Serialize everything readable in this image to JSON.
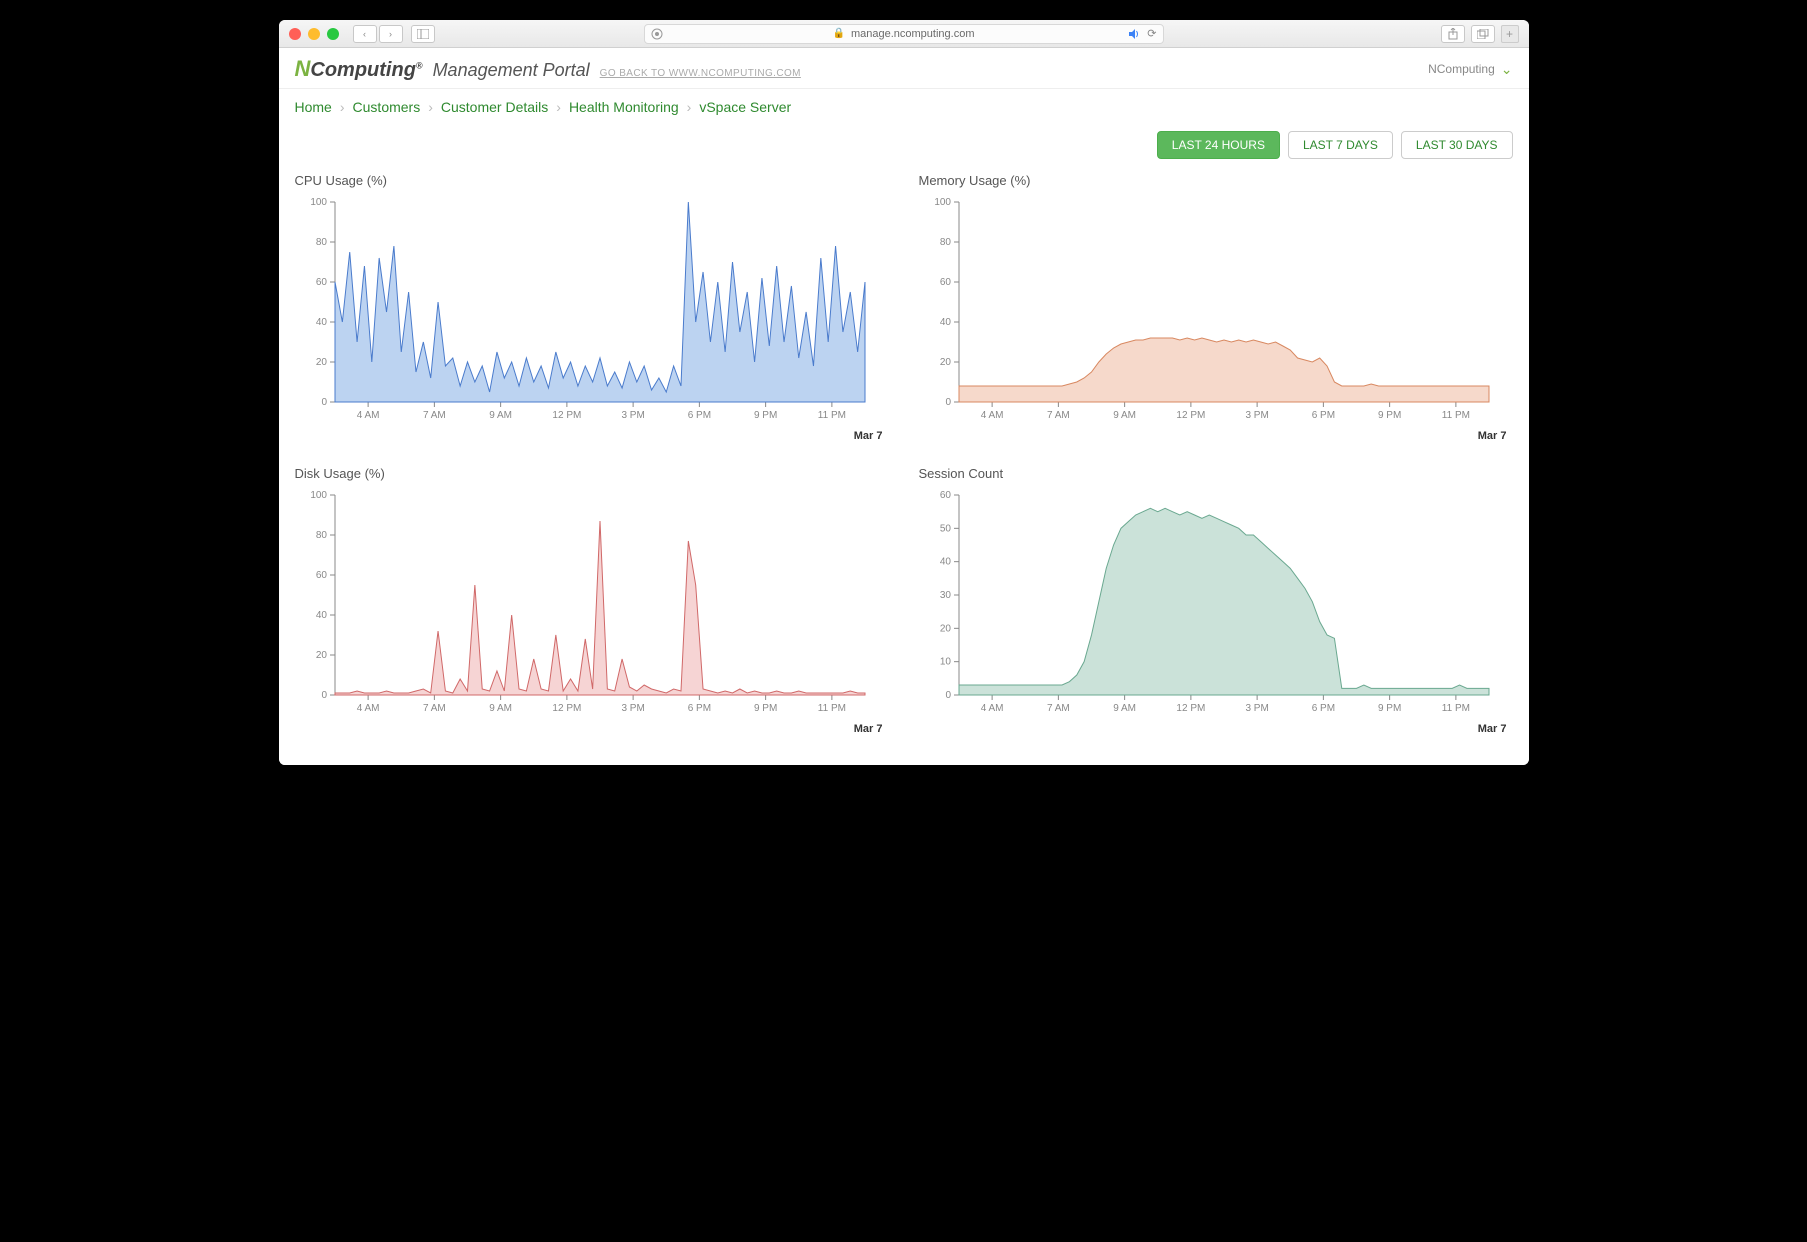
{
  "browser": {
    "url": "manage.ncomputing.com"
  },
  "header": {
    "logo_text": "Computing",
    "portal_title": "Management Portal",
    "goback": "GO BACK TO WWW.NCOMPUTING.COM",
    "user_label": "NComputing"
  },
  "breadcrumb": [
    "Home",
    "Customers",
    "Customer Details",
    "Health Monitoring",
    "vSpace Server"
  ],
  "filters": {
    "items": [
      "LAST 24 HOURS",
      "LAST 7 DAYS",
      "LAST 30 DAYS"
    ],
    "active_index": 0
  },
  "charts_meta": {
    "date_label": "Mar 7",
    "x_categories": [
      "4 AM",
      "7 AM",
      "9 AM",
      "12 PM",
      "3 PM",
      "6 PM",
      "9 PM",
      "11 PM"
    ]
  },
  "chart_data": [
    {
      "id": "cpu",
      "title": "CPU Usage (%)",
      "type": "area",
      "color": "#8fb6e8",
      "stroke": "#4a7bcc",
      "ylim": [
        0,
        100
      ],
      "y_ticks": [
        0,
        20,
        40,
        60,
        80,
        100
      ],
      "x_categories": [
        "4 AM",
        "7 AM",
        "9 AM",
        "12 PM",
        "3 PM",
        "6 PM",
        "9 PM",
        "11 PM"
      ],
      "values": [
        60,
        40,
        75,
        30,
        68,
        20,
        72,
        45,
        78,
        25,
        55,
        15,
        30,
        12,
        50,
        18,
        22,
        8,
        20,
        10,
        18,
        5,
        25,
        12,
        20,
        8,
        22,
        10,
        18,
        7,
        25,
        12,
        20,
        8,
        18,
        10,
        22,
        8,
        15,
        7,
        20,
        10,
        18,
        6,
        12,
        5,
        18,
        8,
        100,
        40,
        65,
        30,
        60,
        25,
        70,
        35,
        55,
        20,
        62,
        28,
        68,
        30,
        58,
        22,
        45,
        18,
        72,
        30,
        78,
        35,
        55,
        25,
        60
      ]
    },
    {
      "id": "memory",
      "title": "Memory Usage (%)",
      "type": "area",
      "color": "#f0c0a8",
      "stroke": "#d88860",
      "ylim": [
        0,
        100
      ],
      "y_ticks": [
        0,
        20,
        40,
        60,
        80,
        100
      ],
      "x_categories": [
        "4 AM",
        "7 AM",
        "9 AM",
        "12 PM",
        "3 PM",
        "6 PM",
        "9 PM",
        "11 PM"
      ],
      "values": [
        8,
        8,
        8,
        8,
        8,
        8,
        8,
        8,
        8,
        8,
        8,
        8,
        8,
        8,
        8,
        9,
        10,
        12,
        15,
        20,
        24,
        27,
        29,
        30,
        31,
        31,
        32,
        32,
        32,
        32,
        31,
        32,
        31,
        32,
        31,
        30,
        31,
        30,
        31,
        30,
        31,
        30,
        29,
        30,
        28,
        26,
        22,
        21,
        20,
        22,
        18,
        10,
        8,
        8,
        8,
        8,
        9,
        8,
        8,
        8,
        8,
        8,
        8,
        8,
        8,
        8,
        8,
        8,
        8,
        8,
        8,
        8,
        8
      ]
    },
    {
      "id": "disk",
      "title": "Disk Usage (%)",
      "type": "area",
      "color": "#f0b8b8",
      "stroke": "#d06868",
      "ylim": [
        0,
        100
      ],
      "y_ticks": [
        0,
        20,
        40,
        60,
        80,
        100
      ],
      "x_categories": [
        "4 AM",
        "7 AM",
        "9 AM",
        "12 PM",
        "3 PM",
        "6 PM",
        "9 PM",
        "11 PM"
      ],
      "values": [
        1,
        1,
        1,
        2,
        1,
        1,
        1,
        2,
        1,
        1,
        1,
        2,
        3,
        1,
        32,
        2,
        1,
        8,
        2,
        55,
        3,
        2,
        12,
        2,
        40,
        3,
        2,
        18,
        3,
        2,
        30,
        2,
        8,
        2,
        28,
        3,
        87,
        3,
        2,
        18,
        4,
        2,
        5,
        3,
        2,
        1,
        3,
        2,
        77,
        55,
        3,
        2,
        1,
        2,
        1,
        3,
        1,
        2,
        1,
        1,
        2,
        1,
        1,
        2,
        1,
        1,
        1,
        1,
        1,
        1,
        2,
        1,
        1
      ]
    },
    {
      "id": "sessions",
      "title": "Session Count",
      "type": "area",
      "color": "#a8cfc0",
      "stroke": "#6aa890",
      "ylim": [
        0,
        60
      ],
      "y_ticks": [
        0,
        10,
        20,
        30,
        40,
        50,
        60
      ],
      "x_categories": [
        "4 AM",
        "7 AM",
        "9 AM",
        "12 PM",
        "3 PM",
        "6 PM",
        "9 PM",
        "11 PM"
      ],
      "values": [
        3,
        3,
        3,
        3,
        3,
        3,
        3,
        3,
        3,
        3,
        3,
        3,
        3,
        3,
        3,
        4,
        6,
        10,
        18,
        28,
        38,
        45,
        50,
        52,
        54,
        55,
        56,
        55,
        56,
        55,
        54,
        55,
        54,
        53,
        54,
        53,
        52,
        51,
        50,
        48,
        48,
        46,
        44,
        42,
        40,
        38,
        35,
        32,
        28,
        22,
        18,
        17,
        2,
        2,
        2,
        3,
        2,
        2,
        2,
        2,
        2,
        2,
        2,
        2,
        2,
        2,
        2,
        2,
        3,
        2,
        2,
        2,
        2
      ]
    }
  ]
}
